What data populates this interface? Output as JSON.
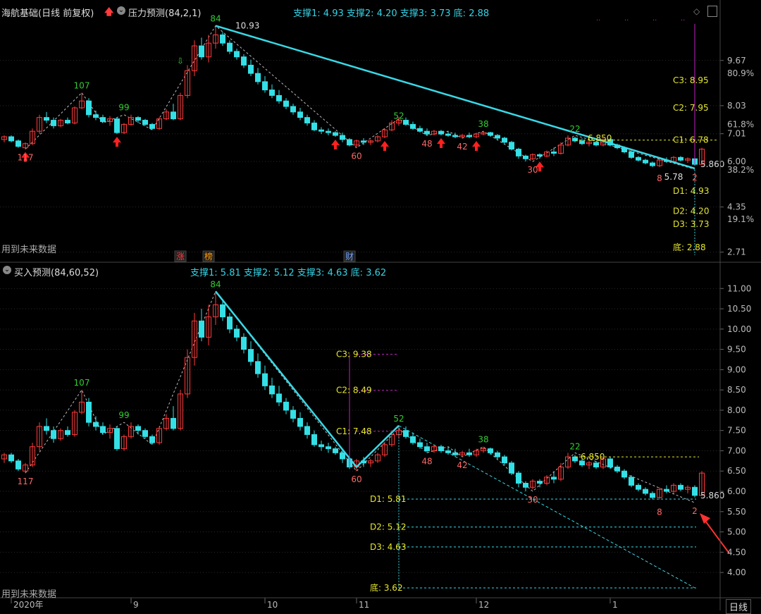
{
  "header": {
    "stock": "海航基础(日线 前复权)",
    "indicator_top": "压力预测(84,2,1)",
    "supports_top": [
      {
        "label": "支撑1:",
        "value": "4.93"
      },
      {
        "label": "支撑2:",
        "value": "4.20"
      },
      {
        "label": "支撑3:",
        "value": "3.73"
      },
      {
        "label": "底:",
        "value": "2.88"
      }
    ],
    "indicator_bottom": "买入预测(84,60,52)",
    "supports_bottom": [
      {
        "label": "支撑1:",
        "value": "5.81"
      },
      {
        "label": "支撑2:",
        "value": "5.12"
      },
      {
        "label": "支撑3:",
        "value": "4.63"
      },
      {
        "label": "底:",
        "value": "3.62"
      }
    ],
    "future_note": "用到未来数据",
    "period_button": "日线"
  },
  "colors": {
    "up": "#ff3b3b",
    "down": "#33e0e6",
    "trend": "#38d9e6",
    "yellow": "#e6e62e",
    "magenta": "#c020c0",
    "green": "#33cc33",
    "grid": "#2a2a2a"
  },
  "event_badges": [
    {
      "text": "涨",
      "color": "#ff3b3b",
      "bar": 25
    },
    {
      "text": "榜",
      "color": "#ff9900",
      "bar": 29
    },
    {
      "text": "财",
      "color": "#6fa0ff",
      "bar": 49
    }
  ],
  "chart_data": [
    {
      "type": "candlestick",
      "title": "压力预测(84,2,1)",
      "ylim": [
        2.6,
        11.2
      ],
      "yticks": [
        {
          "value": 9.67,
          "label": "9.67"
        },
        {
          "value": 8.03,
          "label": "8.03"
        },
        {
          "value": 7.01,
          "label": "7.01"
        },
        {
          "value": 6.0,
          "label": "6.00"
        },
        {
          "value": 4.35,
          "label": "4.35"
        },
        {
          "value": 2.71,
          "label": "2.71"
        }
      ],
      "percent_labels": [
        {
          "value": 9.2,
          "label": "80.9%"
        },
        {
          "value": 7.35,
          "label": "61.8%"
        },
        {
          "value": 5.7,
          "label": "38.2%"
        },
        {
          "value": 3.9,
          "label": "19.1%"
        }
      ],
      "levels": [
        {
          "label": "C3:",
          "value": "8.95",
          "y": 8.95
        },
        {
          "label": "C2:",
          "value": "7.95",
          "y": 7.95
        },
        {
          "label": "C1:",
          "value": "6.78",
          "y": 6.78
        },
        {
          "label": "D1:",
          "value": "4.93",
          "y": 4.93
        },
        {
          "label": "D2:",
          "value": "4.20",
          "y": 4.2
        },
        {
          "label": "D3:",
          "value": "3.73",
          "y": 3.73
        },
        {
          "label": "底:",
          "value": "2.88",
          "y": 2.88
        }
      ],
      "peak_labels": [
        {
          "text": "84",
          "bar": 30,
          "price": 10.93,
          "pos": "above",
          "color": "#33cc33"
        },
        {
          "text": "10.93",
          "bar": 32,
          "price": 10.93,
          "pos": "right",
          "color": "#dddddd"
        },
        {
          "text": "107",
          "bar": 11,
          "price": 8.5,
          "pos": "above",
          "color": "#33cc33"
        },
        {
          "text": "99",
          "bar": 17,
          "price": 7.7,
          "pos": "above",
          "color": "#33cc33"
        },
        {
          "text": "52",
          "bar": 56,
          "price": 7.4,
          "pos": "above",
          "color": "#33cc33"
        },
        {
          "text": "38",
          "bar": 68,
          "price": 7.1,
          "pos": "above",
          "color": "#33cc33"
        },
        {
          "text": "22",
          "bar": 81,
          "price": 6.93,
          "pos": "above",
          "color": "#33cc33"
        },
        {
          "text": "6.850",
          "bar": 82,
          "price": 6.85,
          "pos": "right",
          "color": "#e6e62e"
        },
        {
          "text": "5.860",
          "bar": 98,
          "price": 5.9,
          "pos": "right",
          "color": "#dddddd"
        }
      ],
      "trough_labels": [
        {
          "text": "117",
          "bar": 3,
          "price": 6.45,
          "pos": "below",
          "color": "#ff6666"
        },
        {
          "text": "60",
          "bar": 50,
          "price": 6.5,
          "pos": "below",
          "color": "#ff6666"
        },
        {
          "text": "48",
          "bar": 60,
          "price": 6.95,
          "pos": "below",
          "color": "#ff6666"
        },
        {
          "text": "42",
          "bar": 65,
          "price": 6.85,
          "pos": "below",
          "color": "#ff6666"
        },
        {
          "text": "30",
          "bar": 75,
          "price": 6.0,
          "pos": "below",
          "color": "#ff6666"
        },
        {
          "text": "8",
          "bar": 93,
          "price": 5.7,
          "pos": "below",
          "color": "#ff6666"
        },
        {
          "text": "5.78",
          "bar": 95,
          "price": 5.75,
          "pos": "below",
          "color": "#dddddd"
        },
        {
          "text": "2",
          "bar": 98,
          "price": 5.72,
          "pos": "below",
          "color": "#ff6666"
        }
      ]
    },
    {
      "type": "candlestick",
      "title": "买入预测(84,60,52)",
      "ylim": [
        3.55,
        11.3
      ],
      "yticks": [
        {
          "value": 11.0,
          "label": "11.00"
        },
        {
          "value": 10.5,
          "label": "10.50"
        },
        {
          "value": 10.0,
          "label": "10.00"
        },
        {
          "value": 9.5,
          "label": "9.50"
        },
        {
          "value": 9.0,
          "label": "9.00"
        },
        {
          "value": 8.5,
          "label": "8.50"
        },
        {
          "value": 8.0,
          "label": "8.00"
        },
        {
          "value": 7.5,
          "label": "7.50"
        },
        {
          "value": 7.0,
          "label": "7.00"
        },
        {
          "value": 6.5,
          "label": "6.50"
        },
        {
          "value": 6.0,
          "label": "6.00"
        },
        {
          "value": 5.5,
          "label": "5.50"
        },
        {
          "value": 5.0,
          "label": "5.00"
        },
        {
          "value": 4.5,
          "label": "4.50"
        },
        {
          "value": 4.0,
          "label": "4.00"
        }
      ],
      "levels": [
        {
          "label": "C3:",
          "value": "9.38",
          "y": 9.38
        },
        {
          "label": "C2:",
          "value": "8.49",
          "y": 8.49
        },
        {
          "label": "C1:",
          "value": "7.48",
          "y": 7.48
        },
        {
          "label": "D1:",
          "value": "5.81",
          "y": 5.81
        },
        {
          "label": "D2:",
          "value": "5.12",
          "y": 5.12
        },
        {
          "label": "D3:",
          "value": "4.63",
          "y": 4.63
        },
        {
          "label": "底:",
          "value": "3.62",
          "y": 3.62
        }
      ],
      "peak_labels": [
        {
          "text": "84",
          "bar": 30,
          "price": 10.93,
          "pos": "above",
          "color": "#33cc33"
        },
        {
          "text": "107",
          "bar": 11,
          "price": 8.5,
          "pos": "above",
          "color": "#33cc33"
        },
        {
          "text": "99",
          "bar": 17,
          "price": 7.7,
          "pos": "above",
          "color": "#33cc33"
        },
        {
          "text": "52",
          "bar": 56,
          "price": 7.62,
          "pos": "above",
          "color": "#33cc33"
        },
        {
          "text": "38",
          "bar": 68,
          "price": 7.1,
          "pos": "above",
          "color": "#33cc33"
        },
        {
          "text": "22",
          "bar": 81,
          "price": 6.93,
          "pos": "above",
          "color": "#33cc33"
        },
        {
          "text": "6.850",
          "bar": 81,
          "price": 6.85,
          "pos": "right",
          "color": "#e6e62e"
        },
        {
          "text": "5.860",
          "bar": 98,
          "price": 5.9,
          "pos": "right",
          "color": "#dddddd"
        }
      ],
      "trough_labels": [
        {
          "text": "117",
          "bar": 3,
          "price": 6.45,
          "pos": "below",
          "color": "#ff6666"
        },
        {
          "text": "60",
          "bar": 50,
          "price": 6.5,
          "pos": "below",
          "color": "#ff6666"
        },
        {
          "text": "48",
          "bar": 60,
          "price": 6.95,
          "pos": "below",
          "color": "#ff6666"
        },
        {
          "text": "42",
          "bar": 65,
          "price": 6.85,
          "pos": "below",
          "color": "#ff6666"
        },
        {
          "text": "30",
          "bar": 75,
          "price": 6.0,
          "pos": "below",
          "color": "#ff6666"
        },
        {
          "text": "8",
          "bar": 93,
          "price": 5.7,
          "pos": "below",
          "color": "#ff6666"
        },
        {
          "text": "2",
          "bar": 98,
          "price": 5.72,
          "pos": "below",
          "color": "#ff6666"
        }
      ]
    }
  ],
  "x_axis": {
    "labels": [
      {
        "text": "2020年",
        "bar": 1
      },
      {
        "text": "9",
        "bar": 18
      },
      {
        "text": "10",
        "bar": 37
      },
      {
        "text": "11",
        "bar": 50
      },
      {
        "text": "12",
        "bar": 67
      },
      {
        "text": "1",
        "bar": 86
      }
    ]
  },
  "candles": [
    {
      "o": 6.8,
      "h": 6.95,
      "l": 6.7,
      "c": 6.9
    },
    {
      "o": 6.9,
      "h": 6.95,
      "l": 6.7,
      "c": 6.75
    },
    {
      "o": 6.75,
      "h": 6.8,
      "l": 6.5,
      "c": 6.55
    },
    {
      "o": 6.5,
      "h": 6.7,
      "l": 6.45,
      "c": 6.65
    },
    {
      "o": 6.65,
      "h": 7.2,
      "l": 6.6,
      "c": 7.1
    },
    {
      "o": 7.1,
      "h": 7.7,
      "l": 7.0,
      "c": 7.6
    },
    {
      "o": 7.6,
      "h": 7.8,
      "l": 7.4,
      "c": 7.5
    },
    {
      "o": 7.5,
      "h": 7.6,
      "l": 7.2,
      "c": 7.3
    },
    {
      "o": 7.3,
      "h": 7.55,
      "l": 7.25,
      "c": 7.5
    },
    {
      "o": 7.5,
      "h": 7.6,
      "l": 7.35,
      "c": 7.4
    },
    {
      "o": 7.4,
      "h": 8.0,
      "l": 7.35,
      "c": 7.95
    },
    {
      "o": 7.95,
      "h": 8.5,
      "l": 7.9,
      "c": 8.2
    },
    {
      "o": 8.2,
      "h": 8.3,
      "l": 7.6,
      "c": 7.7
    },
    {
      "o": 7.7,
      "h": 7.85,
      "l": 7.5,
      "c": 7.6
    },
    {
      "o": 7.6,
      "h": 7.7,
      "l": 7.4,
      "c": 7.45
    },
    {
      "o": 7.45,
      "h": 7.65,
      "l": 7.3,
      "c": 7.55
    },
    {
      "o": 7.55,
      "h": 7.6,
      "l": 7.0,
      "c": 7.05
    },
    {
      "o": 7.05,
      "h": 7.4,
      "l": 7.0,
      "c": 7.35
    },
    {
      "o": 7.35,
      "h": 7.7,
      "l": 7.3,
      "c": 7.6
    },
    {
      "o": 7.6,
      "h": 7.65,
      "l": 7.4,
      "c": 7.5
    },
    {
      "o": 7.5,
      "h": 7.55,
      "l": 7.3,
      "c": 7.35
    },
    {
      "o": 7.35,
      "h": 7.4,
      "l": 7.15,
      "c": 7.2
    },
    {
      "o": 7.2,
      "h": 7.6,
      "l": 7.15,
      "c": 7.55
    },
    {
      "o": 7.55,
      "h": 7.9,
      "l": 7.5,
      "c": 7.8
    },
    {
      "o": 7.8,
      "h": 8.1,
      "l": 7.5,
      "c": 7.55
    },
    {
      "o": 7.55,
      "h": 8.5,
      "l": 7.5,
      "c": 8.4
    },
    {
      "o": 8.4,
      "h": 9.5,
      "l": 8.3,
      "c": 9.3
    },
    {
      "o": 9.3,
      "h": 10.4,
      "l": 9.1,
      "c": 10.2
    },
    {
      "o": 10.2,
      "h": 10.5,
      "l": 9.7,
      "c": 9.8
    },
    {
      "o": 9.8,
      "h": 10.6,
      "l": 9.6,
      "c": 10.3
    },
    {
      "o": 10.3,
      "h": 10.93,
      "l": 10.1,
      "c": 10.6
    },
    {
      "o": 10.6,
      "h": 10.7,
      "l": 10.2,
      "c": 10.3
    },
    {
      "o": 10.3,
      "h": 10.4,
      "l": 9.9,
      "c": 10.0
    },
    {
      "o": 10.0,
      "h": 10.1,
      "l": 9.7,
      "c": 9.8
    },
    {
      "o": 9.8,
      "h": 9.9,
      "l": 9.4,
      "c": 9.5
    },
    {
      "o": 9.5,
      "h": 9.7,
      "l": 9.1,
      "c": 9.2
    },
    {
      "o": 9.2,
      "h": 9.4,
      "l": 8.8,
      "c": 8.9
    },
    {
      "o": 8.9,
      "h": 9.1,
      "l": 8.5,
      "c": 8.6
    },
    {
      "o": 8.6,
      "h": 8.8,
      "l": 8.3,
      "c": 8.4
    },
    {
      "o": 8.4,
      "h": 8.6,
      "l": 8.1,
      "c": 8.2
    },
    {
      "o": 8.2,
      "h": 8.3,
      "l": 7.9,
      "c": 8.0
    },
    {
      "o": 8.0,
      "h": 8.1,
      "l": 7.7,
      "c": 7.8
    },
    {
      "o": 7.8,
      "h": 7.95,
      "l": 7.5,
      "c": 7.6
    },
    {
      "o": 7.6,
      "h": 7.7,
      "l": 7.3,
      "c": 7.4
    },
    {
      "o": 7.4,
      "h": 7.5,
      "l": 7.1,
      "c": 7.15
    },
    {
      "o": 7.15,
      "h": 7.25,
      "l": 7.0,
      "c": 7.1
    },
    {
      "o": 7.1,
      "h": 7.2,
      "l": 6.95,
      "c": 7.05
    },
    {
      "o": 7.05,
      "h": 7.1,
      "l": 6.9,
      "c": 6.95
    },
    {
      "o": 6.95,
      "h": 7.05,
      "l": 6.7,
      "c": 6.8
    },
    {
      "o": 6.8,
      "h": 6.85,
      "l": 6.55,
      "c": 6.6
    },
    {
      "o": 6.6,
      "h": 6.8,
      "l": 6.5,
      "c": 6.75
    },
    {
      "o": 6.75,
      "h": 6.85,
      "l": 6.6,
      "c": 6.7
    },
    {
      "o": 6.7,
      "h": 6.8,
      "l": 6.6,
      "c": 6.75
    },
    {
      "o": 6.75,
      "h": 6.95,
      "l": 6.7,
      "c": 6.9
    },
    {
      "o": 6.9,
      "h": 7.2,
      "l": 6.85,
      "c": 7.15
    },
    {
      "o": 7.15,
      "h": 7.5,
      "l": 7.1,
      "c": 7.4
    },
    {
      "o": 7.4,
      "h": 7.62,
      "l": 7.3,
      "c": 7.5
    },
    {
      "o": 7.5,
      "h": 7.6,
      "l": 7.3,
      "c": 7.35
    },
    {
      "o": 7.35,
      "h": 7.45,
      "l": 7.15,
      "c": 7.2
    },
    {
      "o": 7.2,
      "h": 7.3,
      "l": 7.05,
      "c": 7.1
    },
    {
      "o": 7.1,
      "h": 7.2,
      "l": 6.95,
      "c": 7.0
    },
    {
      "o": 7.0,
      "h": 7.15,
      "l": 6.95,
      "c": 7.1
    },
    {
      "o": 7.1,
      "h": 7.15,
      "l": 6.95,
      "c": 7.0
    },
    {
      "o": 7.0,
      "h": 7.1,
      "l": 6.9,
      "c": 6.95
    },
    {
      "o": 6.95,
      "h": 7.05,
      "l": 6.85,
      "c": 6.9
    },
    {
      "o": 6.9,
      "h": 7.0,
      "l": 6.85,
      "c": 6.95
    },
    {
      "o": 6.95,
      "h": 7.05,
      "l": 6.85,
      "c": 6.9
    },
    {
      "o": 6.9,
      "h": 7.05,
      "l": 6.85,
      "c": 7.0
    },
    {
      "o": 7.0,
      "h": 7.1,
      "l": 6.95,
      "c": 7.05
    },
    {
      "o": 7.05,
      "h": 7.08,
      "l": 6.9,
      "c": 6.95
    },
    {
      "o": 6.95,
      "h": 7.0,
      "l": 6.8,
      "c": 6.85
    },
    {
      "o": 6.85,
      "h": 6.9,
      "l": 6.65,
      "c": 6.7
    },
    {
      "o": 6.7,
      "h": 6.75,
      "l": 6.4,
      "c": 6.45
    },
    {
      "o": 6.45,
      "h": 6.5,
      "l": 6.1,
      "c": 6.2
    },
    {
      "o": 6.2,
      "h": 6.25,
      "l": 6.0,
      "c": 6.1
    },
    {
      "o": 6.1,
      "h": 6.3,
      "l": 6.05,
      "c": 6.25
    },
    {
      "o": 6.25,
      "h": 6.3,
      "l": 6.1,
      "c": 6.2
    },
    {
      "o": 6.2,
      "h": 6.4,
      "l": 6.15,
      "c": 6.35
    },
    {
      "o": 6.35,
      "h": 6.5,
      "l": 6.2,
      "c": 6.3
    },
    {
      "o": 6.3,
      "h": 6.7,
      "l": 6.25,
      "c": 6.6
    },
    {
      "o": 6.6,
      "h": 6.95,
      "l": 6.55,
      "c": 6.85
    },
    {
      "o": 6.85,
      "h": 6.9,
      "l": 6.7,
      "c": 6.75
    },
    {
      "o": 6.75,
      "h": 6.85,
      "l": 6.6,
      "c": 6.65
    },
    {
      "o": 6.65,
      "h": 6.75,
      "l": 6.55,
      "c": 6.7
    },
    {
      "o": 6.7,
      "h": 6.75,
      "l": 6.55,
      "c": 6.6
    },
    {
      "o": 6.6,
      "h": 6.85,
      "l": 6.55,
      "c": 6.8
    },
    {
      "o": 6.8,
      "h": 6.85,
      "l": 6.55,
      "c": 6.6
    },
    {
      "o": 6.6,
      "h": 6.65,
      "l": 6.45,
      "c": 6.5
    },
    {
      "o": 6.5,
      "h": 6.55,
      "l": 6.3,
      "c": 6.35
    },
    {
      "o": 6.35,
      "h": 6.4,
      "l": 6.1,
      "c": 6.15
    },
    {
      "o": 6.15,
      "h": 6.2,
      "l": 6.0,
      "c": 6.05
    },
    {
      "o": 6.05,
      "h": 6.1,
      "l": 5.9,
      "c": 5.95
    },
    {
      "o": 5.95,
      "h": 6.0,
      "l": 5.8,
      "c": 5.85
    },
    {
      "o": 5.85,
      "h": 6.1,
      "l": 5.8,
      "c": 6.05
    },
    {
      "o": 6.05,
      "h": 6.15,
      "l": 5.95,
      "c": 6.0
    },
    {
      "o": 6.0,
      "h": 6.2,
      "l": 5.95,
      "c": 6.15
    },
    {
      "o": 6.15,
      "h": 6.2,
      "l": 6.0,
      "c": 6.05
    },
    {
      "o": 6.05,
      "h": 6.15,
      "l": 5.95,
      "c": 6.1
    },
    {
      "o": 6.1,
      "h": 6.15,
      "l": 5.85,
      "c": 5.9
    },
    {
      "o": 5.9,
      "h": 6.5,
      "l": 5.88,
      "c": 6.45
    }
  ]
}
